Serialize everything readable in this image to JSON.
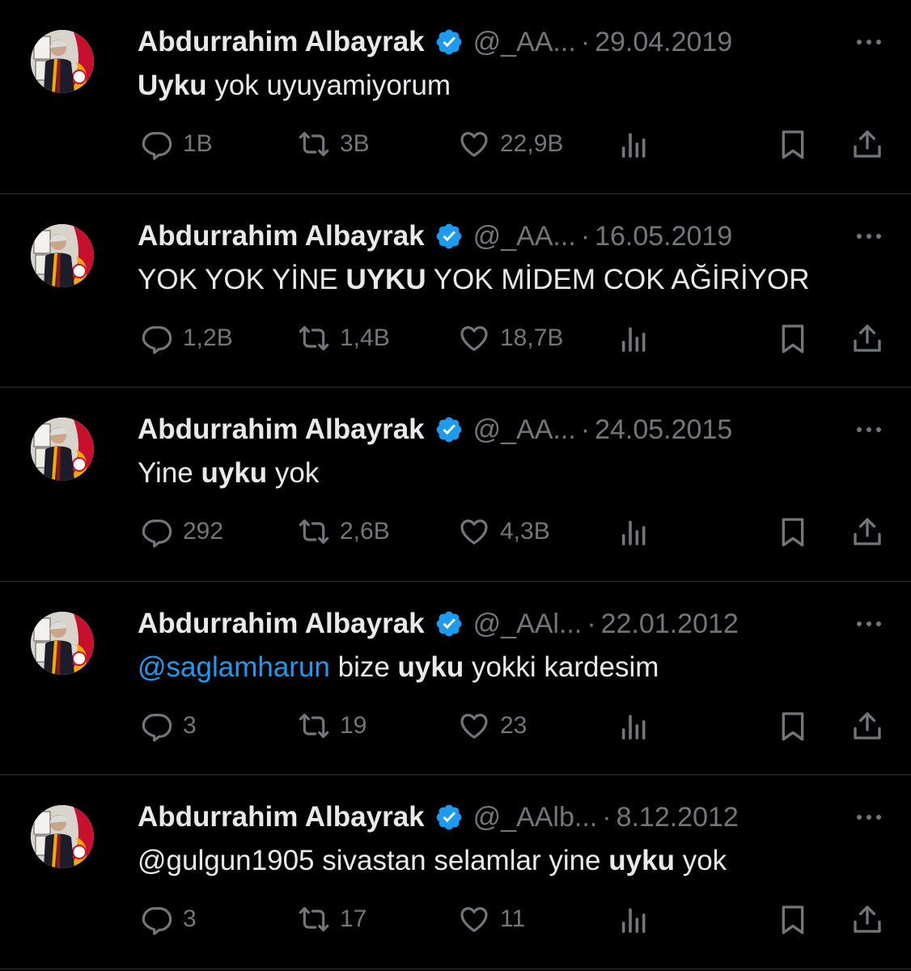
{
  "colors": {
    "background": "#000000",
    "text": "#e7e9ea",
    "muted": "#71767b",
    "link": "#1d9bf0",
    "verified": "#1d9bf0",
    "divider": "#2f3336"
  },
  "tweets": [
    {
      "name": "Abdurrahim Albayrak",
      "handle": "@_AA...",
      "sep": "·",
      "date": "29.04.2019",
      "segments": [
        {
          "t": "Uyku",
          "b": true
        },
        {
          "t": " yok uyuyamiyorum"
        }
      ],
      "replies": "1B",
      "retweets": "3B",
      "likes": "22,9B"
    },
    {
      "name": "Abdurrahim Albayrak",
      "handle": "@_AA...",
      "sep": "·",
      "date": "16.05.2019",
      "segments": [
        {
          "t": "YOK YOK YİNE "
        },
        {
          "t": "UYKU",
          "b": true
        },
        {
          "t": " YOK MİDEM COK AĞİRİYOR"
        }
      ],
      "replies": "1,2B",
      "retweets": "1,4B",
      "likes": "18,7B"
    },
    {
      "name": "Abdurrahim Albayrak",
      "handle": "@_AA...",
      "sep": "·",
      "date": "24.05.2015",
      "segments": [
        {
          "t": "Yine "
        },
        {
          "t": "uyku",
          "b": true
        },
        {
          "t": " yok"
        }
      ],
      "replies": "292",
      "retweets": "2,6B",
      "likes": "4,3B"
    },
    {
      "name": "Abdurrahim Albayrak",
      "handle": "@_AAl...",
      "sep": "·",
      "date": "22.01.2012",
      "segments": [
        {
          "t": "@saglamharun",
          "m": true
        },
        {
          "t": " bize "
        },
        {
          "t": "uyku",
          "b": true
        },
        {
          "t": " yokki kardesim"
        }
      ],
      "replies": "3",
      "retweets": "19",
      "likes": "23"
    },
    {
      "name": "Abdurrahim Albayrak",
      "handle": "@_AAlb...",
      "sep": "·",
      "date": "8.12.2012",
      "segments": [
        {
          "t": "@gulgun1905 sivastan selamlar yine "
        },
        {
          "t": "uyku",
          "b": true
        },
        {
          "t": " yok"
        }
      ],
      "replies": "3",
      "retweets": "17",
      "likes": "11"
    }
  ]
}
